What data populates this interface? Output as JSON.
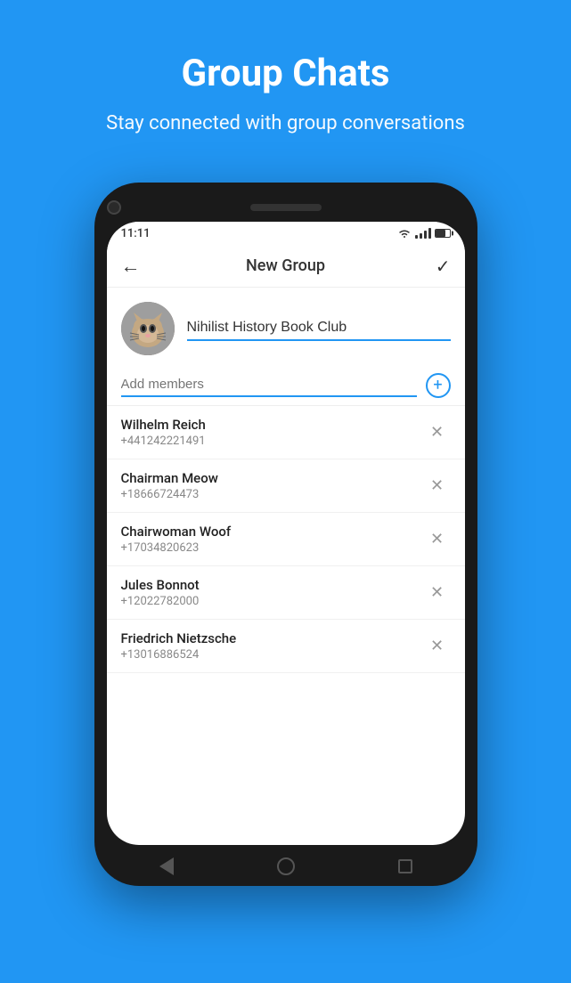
{
  "hero": {
    "title": "Group Chats",
    "subtitle": "Stay connected with group conversations"
  },
  "colors": {
    "brand": "#2196F3",
    "background": "#2196F3"
  },
  "phone": {
    "status_bar": {
      "time": "11:11"
    },
    "toolbar": {
      "title": "New Group",
      "back_icon": "←",
      "check_icon": "✓"
    },
    "group": {
      "name_placeholder": "Nihilist History Book Club",
      "name_value": "Nihilist History Book Club"
    },
    "add_members": {
      "placeholder": "Add members"
    },
    "members": [
      {
        "name": "Wilhelm Reich",
        "phone": "+441242221491"
      },
      {
        "name": "Chairman Meow",
        "phone": "+18666724473"
      },
      {
        "name": "Chairwoman Woof",
        "phone": "+17034820623"
      },
      {
        "name": "Jules Bonnot",
        "phone": "+12022782000"
      },
      {
        "name": "Friedrich Nietzsche",
        "phone": "+13016886524"
      }
    ]
  }
}
